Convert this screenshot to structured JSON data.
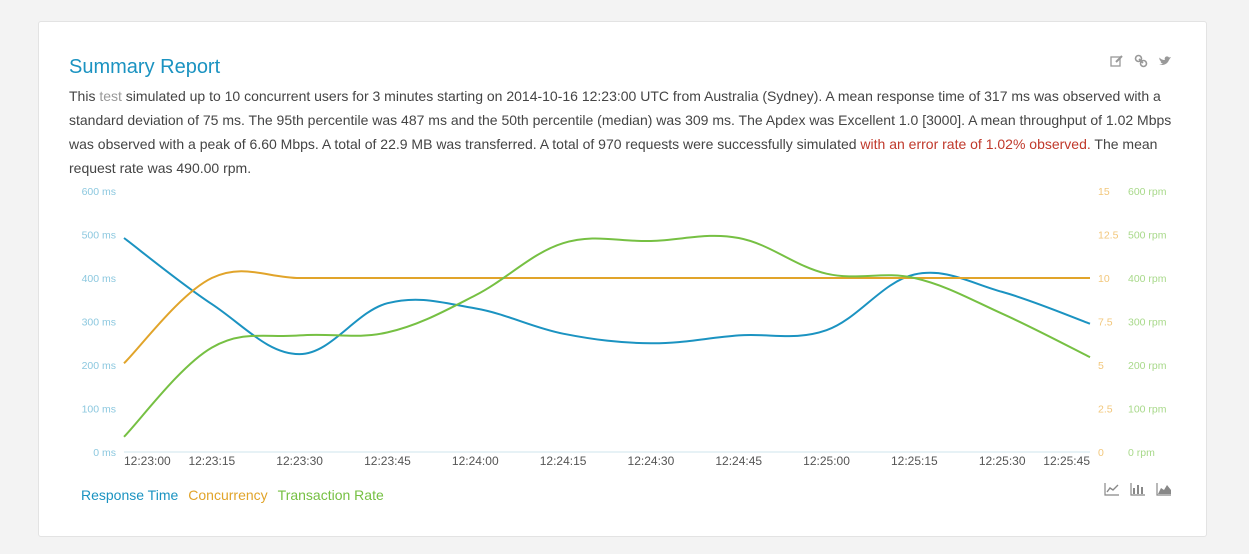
{
  "report": {
    "title": "Summary Report",
    "summary": {
      "part1": "This ",
      "link": "test",
      "part2": " simulated up to 10 concurrent users for 3 minutes starting on 2014-10-16 12:23:00 UTC from Australia (Sydney). A mean response time of 317 ms was observed with a standard deviation of 75 ms. The 95th percentile was 487 ms and the 50th percentile (median) was 309 ms. The Apdex was Excellent 1.0 [3000]. A mean throughput of 1.02 Mbps was observed with a peak of 6.60 Mbps. A total of 22.9 MB was transferred. A total of 970 requests were successfully simulated ",
      "error": "with an error rate of 1.02% observed.",
      "part3": " The mean request rate was 490.00 rpm."
    },
    "icons": {
      "top": [
        "edit-icon",
        "link-icon",
        "twitter-icon"
      ],
      "bottom": [
        "line-chart-icon",
        "bar-chart-icon",
        "area-chart-icon"
      ]
    }
  },
  "colors": {
    "response": "#1b93c1",
    "concurrency": "#e1a42a",
    "transaction": "#76c043",
    "axis_left": "#8cc8df",
    "axis_right_mid": "#f2c77b",
    "axis_right_far": "#a8d98a",
    "error_text": "#c0392b"
  },
  "chart_data": {
    "type": "line",
    "x": [
      "12:23:00",
      "12:23:15",
      "12:23:30",
      "12:23:45",
      "12:24:00",
      "12:24:15",
      "12:24:30",
      "12:24:45",
      "12:25:00",
      "12:25:15",
      "12:25:30",
      "12:25:45"
    ],
    "y_left": {
      "ticks": [
        "0 ms",
        "100 ms",
        "200 ms",
        "300 ms",
        "400 ms",
        "500 ms",
        "600 ms"
      ],
      "ylim": [
        0,
        600
      ]
    },
    "y_right1": {
      "ticks": [
        "0",
        "2.5",
        "5",
        "7.5",
        "10",
        "12.5",
        "15"
      ],
      "ylim": [
        0,
        15
      ]
    },
    "y_right2": {
      "ticks": [
        "0 rpm",
        "100 rpm",
        "200 rpm",
        "300 rpm",
        "400 rpm",
        "500 rpm",
        "600 rpm"
      ],
      "ylim": [
        0,
        600
      ]
    },
    "series": [
      {
        "name": "Response Time",
        "axis": "left",
        "t": [
          0,
          15,
          30,
          45,
          60,
          75,
          90,
          105,
          120,
          135,
          150,
          165
        ],
        "values": [
          492,
          340,
          225,
          342,
          330,
          272,
          250,
          268,
          280,
          408,
          368,
          295
        ]
      },
      {
        "name": "Concurrency",
        "axis": "right1",
        "t": [
          0,
          15,
          30,
          45,
          60,
          75,
          90,
          105,
          120,
          135,
          150,
          165
        ],
        "values": [
          5.1,
          10,
          10,
          10,
          10,
          10,
          10,
          10,
          10,
          10,
          10,
          10
        ]
      },
      {
        "name": "Transaction Rate",
        "axis": "right2",
        "t": [
          0,
          15,
          30,
          45,
          60,
          75,
          90,
          105,
          120,
          135,
          150,
          165
        ],
        "values": [
          35,
          240,
          268,
          275,
          360,
          480,
          485,
          492,
          410,
          400,
          318,
          218
        ]
      }
    ],
    "legend": "bottom-left",
    "grid": false
  }
}
